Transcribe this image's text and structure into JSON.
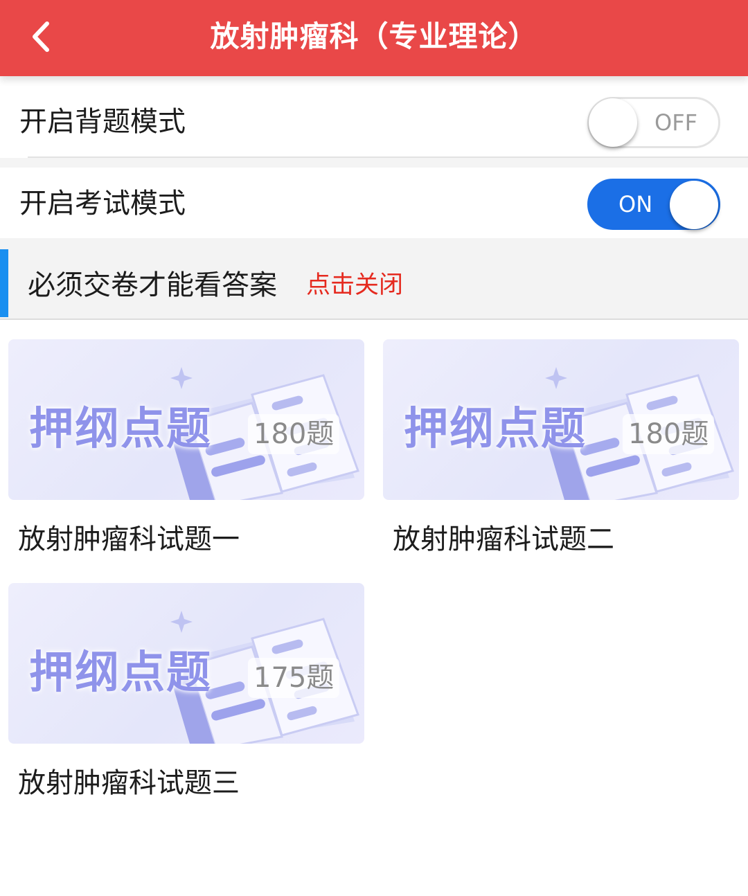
{
  "header": {
    "title": "放射肿瘤科（专业理论）",
    "back_icon": "chevron-left-icon",
    "bg_color": "#e94848"
  },
  "settings": [
    {
      "label": "开启背题模式",
      "toggle_text": "OFF",
      "on": false
    },
    {
      "label": "开启考试模式",
      "toggle_text": "ON",
      "on": true
    }
  ],
  "notice": {
    "text": "必须交卷才能看答案",
    "link": "点击关闭",
    "accent_color": "#1a8ff0",
    "link_color": "#e52a1f"
  },
  "cards": [
    {
      "thumb_title": "押纲点题",
      "count": "180题",
      "title": "放射肿瘤科试题一"
    },
    {
      "thumb_title": "押纲点题",
      "count": "180题",
      "title": "放射肿瘤科试题二"
    },
    {
      "thumb_title": "押纲点题",
      "count": "175题",
      "title": "放射肿瘤科试题三"
    }
  ]
}
